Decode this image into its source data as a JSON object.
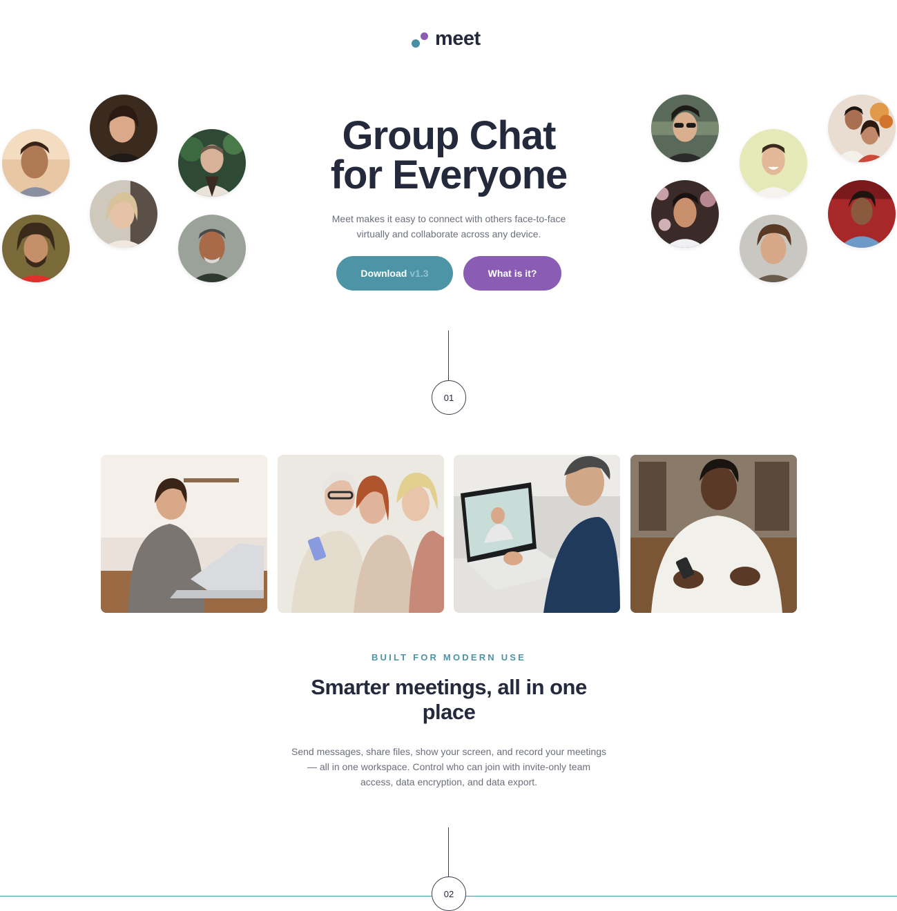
{
  "brand": {
    "name": "meet",
    "colors": {
      "teal": "#4c94a6",
      "purple": "#8a5cb3",
      "ink": "#242a3b",
      "muted": "#6b6f7b"
    }
  },
  "hero": {
    "title_line1": "Group Chat",
    "title_line2": "for Everyone",
    "subtitle": "Meet makes it easy to connect with others face-to-face virtually and collaborate across any device.",
    "download_label": "Download",
    "download_version": "v1.3",
    "what_label": "What is it?"
  },
  "steps": {
    "first": "01",
    "second": "02"
  },
  "features": {
    "eyebrow": "BUILT FOR MODERN USE",
    "title": "Smarter meetings, all in one place",
    "body": "Send messages, share files, show your screen, and record your meetings — all in one workspace. Control who can join with invite-only team access, data encryption, and data export."
  }
}
